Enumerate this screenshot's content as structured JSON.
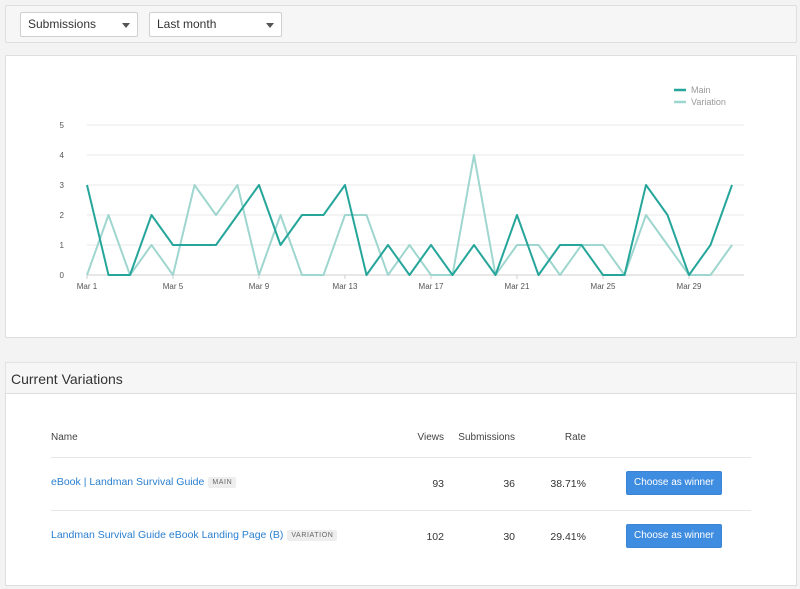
{
  "filters": {
    "metric": "Submissions",
    "period": "Last month"
  },
  "chart_data": {
    "type": "line",
    "x": [
      "Mar 1",
      "Mar 2",
      "Mar 3",
      "Mar 4",
      "Mar 5",
      "Mar 6",
      "Mar 7",
      "Mar 8",
      "Mar 9",
      "Mar 10",
      "Mar 11",
      "Mar 12",
      "Mar 13",
      "Mar 14",
      "Mar 15",
      "Mar 16",
      "Mar 17",
      "Mar 18",
      "Mar 19",
      "Mar 20",
      "Mar 21",
      "Mar 22",
      "Mar 23",
      "Mar 24",
      "Mar 25",
      "Mar 26",
      "Mar 27",
      "Mar 28",
      "Mar 29",
      "Mar 30",
      "Mar 31"
    ],
    "x_tick_labels": [
      "Mar 1",
      "Mar 5",
      "Mar 9",
      "Mar 13",
      "Mar 17",
      "Mar 21",
      "Mar 25",
      "Mar 29"
    ],
    "y_ticks": [
      0,
      1,
      2,
      3,
      4,
      5
    ],
    "ylim": [
      0,
      5
    ],
    "grid": true,
    "legend_position": "top-right",
    "series": [
      {
        "name": "Main",
        "color": "#26a69a",
        "values": [
          3,
          0,
          0,
          2,
          1,
          1,
          1,
          2,
          3,
          1,
          2,
          2,
          3,
          0,
          1,
          0,
          1,
          0,
          1,
          0,
          2,
          0,
          1,
          1,
          0,
          0,
          3,
          2,
          0,
          1,
          3
        ]
      },
      {
        "name": "Variation",
        "color": "#9fd6cf",
        "values": [
          0,
          2,
          0,
          1,
          0,
          3,
          2,
          3,
          0,
          2,
          0,
          0,
          2,
          2,
          0,
          1,
          0,
          0,
          4,
          0,
          1,
          1,
          0,
          1,
          1,
          0,
          2,
          1,
          0,
          0,
          1
        ]
      }
    ]
  },
  "variations": {
    "title": "Current Variations",
    "columns": {
      "name": "Name",
      "views": "Views",
      "submissions": "Submissions",
      "rate": "Rate"
    },
    "rows": [
      {
        "name": "eBook | Landman Survival Guide",
        "badge": "MAIN",
        "views": "93",
        "submissions": "36",
        "rate": "38.71%",
        "action": "Choose as winner"
      },
      {
        "name": "Landman Survival Guide eBook Landing Page (B)",
        "badge": "VARIATION",
        "views": "102",
        "submissions": "30",
        "rate": "29.41%",
        "action": "Choose as winner"
      }
    ]
  }
}
